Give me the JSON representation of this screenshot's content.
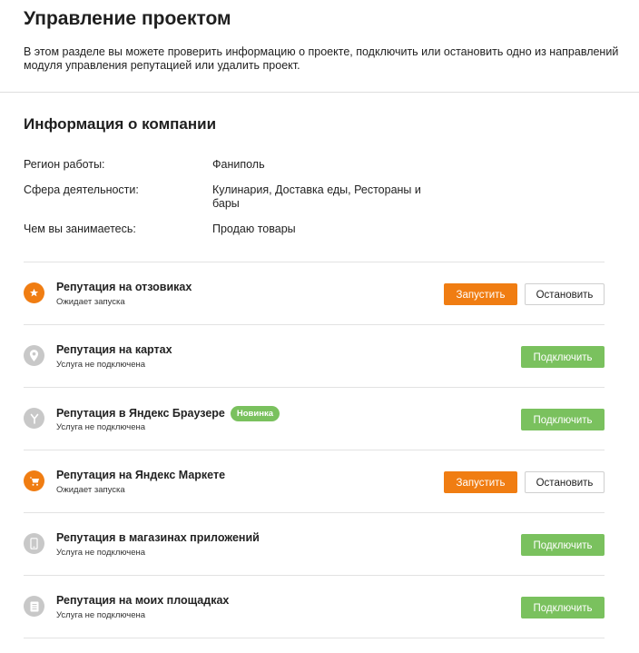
{
  "header": {
    "title": "Управление проектом",
    "description": "В этом разделе вы можете проверить информацию о проекте, подключить или остановить одно из направлений модуля управления репутацией или удалить проект."
  },
  "company_info": {
    "title": "Информация о компании",
    "rows": [
      {
        "label": "Регион работы:",
        "value": "Фаниполь"
      },
      {
        "label": "Сфера деятельности:",
        "value": "Кулинария, Доставка еды, Рестораны и бары"
      },
      {
        "label": "Чем вы занимаетесь:",
        "value": "Продаю товары"
      }
    ]
  },
  "services": [
    {
      "title": "Репутация на отзовиках",
      "status": "Ожидает запуска",
      "icon": "star-icon",
      "icon_color": "#f07d12",
      "start_label": "Запустить",
      "stop_label": "Остановить"
    },
    {
      "title": "Репутация на картах",
      "status": "Услуга не подключена",
      "icon": "map-pin-icon",
      "icon_color": "#c8c8c8",
      "connect_label": "Подключить"
    },
    {
      "title": "Репутация в Яндекс Браузере",
      "badge": "Новинка",
      "status": "Услуга не подключена",
      "icon": "yandex-browser-icon",
      "icon_color": "#c8c8c8",
      "connect_label": "Подключить"
    },
    {
      "title": "Репутация на Яндекс Маркете",
      "status": "Ожидает запуска",
      "icon": "shopping-cart-icon",
      "icon_color": "#f07d12",
      "start_label": "Запустить",
      "stop_label": "Остановить"
    },
    {
      "title": "Репутация в магазинах приложений",
      "status": "Услуга не подключена",
      "icon": "smartphone-icon",
      "icon_color": "#c8c8c8",
      "connect_label": "Подключить"
    },
    {
      "title": "Репутация на моих площадках",
      "status": "Услуга не подключена",
      "icon": "document-icon",
      "icon_color": "#c8c8c8",
      "connect_label": "Подключить"
    }
  ],
  "colors": {
    "accent_orange": "#f07d12",
    "accent_green": "#7ac15e",
    "inactive_gray": "#c8c8c8"
  }
}
